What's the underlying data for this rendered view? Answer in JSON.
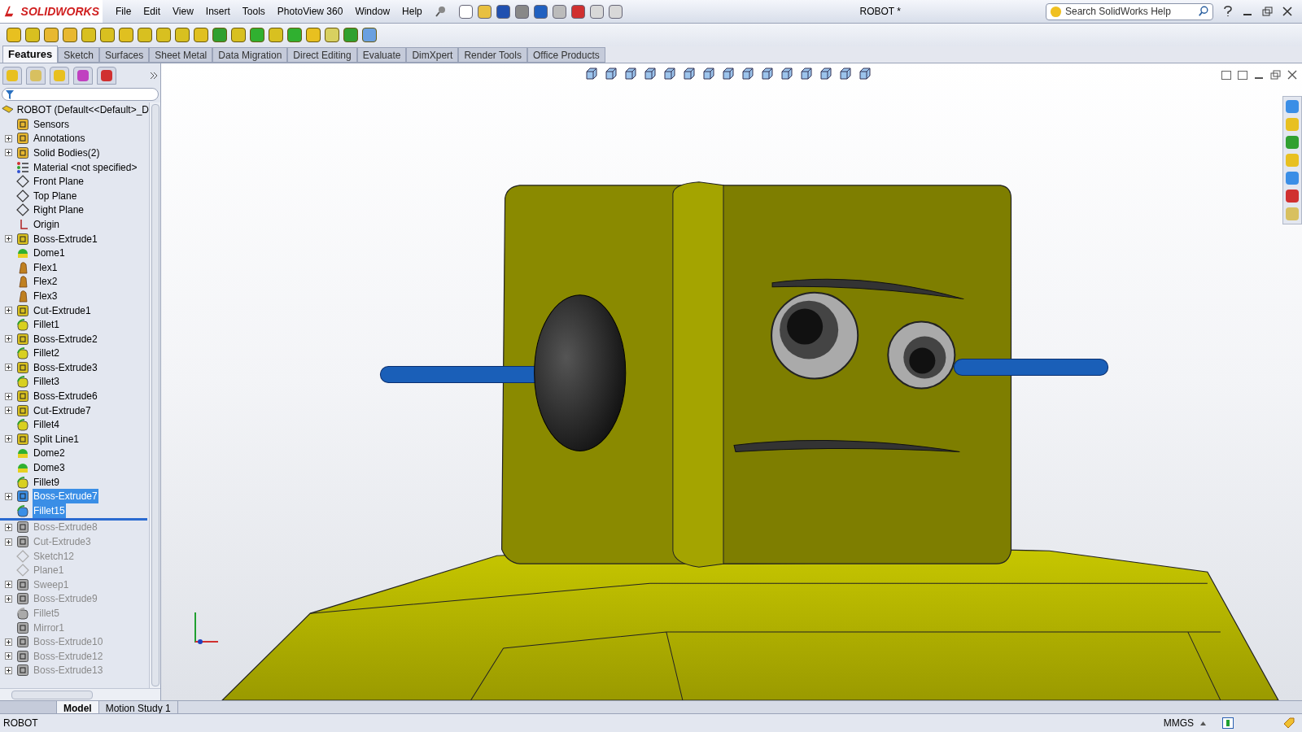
{
  "app": {
    "logo": "SOLIDWORKS",
    "title": "ROBOT *"
  },
  "menu": [
    "File",
    "Edit",
    "View",
    "Insert",
    "Tools",
    "PhotoView 360",
    "Window",
    "Help"
  ],
  "search": {
    "placeholder": "Search SolidWorks Help"
  },
  "command_tabs": [
    {
      "label": "Features",
      "selected": true
    },
    {
      "label": "Sketch",
      "selected": false
    },
    {
      "label": "Surfaces",
      "selected": false
    },
    {
      "label": "Sheet Metal",
      "selected": false
    },
    {
      "label": "Data Migration",
      "selected": false
    },
    {
      "label": "Direct Editing",
      "selected": false
    },
    {
      "label": "Evaluate",
      "selected": false
    },
    {
      "label": "DimXpert",
      "selected": false
    },
    {
      "label": "Render Tools",
      "selected": false
    },
    {
      "label": "Office Products",
      "selected": false
    }
  ],
  "feature_tree": {
    "root": "ROBOT  (Default<<Default>_D",
    "items": [
      {
        "label": "Sensors",
        "kind": "sensor",
        "expandable": false,
        "selected": false,
        "suppressed": false
      },
      {
        "label": "Annotations",
        "kind": "annotation",
        "expandable": true,
        "selected": false,
        "suppressed": false
      },
      {
        "label": "Solid Bodies(2)",
        "kind": "bodies",
        "expandable": true,
        "selected": false,
        "suppressed": false
      },
      {
        "label": "Material <not specified>",
        "kind": "material",
        "expandable": false,
        "selected": false,
        "suppressed": false
      },
      {
        "label": "Front Plane",
        "kind": "plane",
        "expandable": false,
        "selected": false,
        "suppressed": false
      },
      {
        "label": "Top Plane",
        "kind": "plane",
        "expandable": false,
        "selected": false,
        "suppressed": false
      },
      {
        "label": "Right Plane",
        "kind": "plane",
        "expandable": false,
        "selected": false,
        "suppressed": false
      },
      {
        "label": "Origin",
        "kind": "origin",
        "expandable": false,
        "selected": false,
        "suppressed": false
      },
      {
        "label": "Boss-Extrude1",
        "kind": "boss",
        "expandable": true,
        "selected": false,
        "suppressed": false
      },
      {
        "label": "Dome1",
        "kind": "dome",
        "expandable": false,
        "selected": false,
        "suppressed": false
      },
      {
        "label": "Flex1",
        "kind": "flex",
        "expandable": false,
        "selected": false,
        "suppressed": false
      },
      {
        "label": "Flex2",
        "kind": "flex",
        "expandable": false,
        "selected": false,
        "suppressed": false
      },
      {
        "label": "Flex3",
        "kind": "flex",
        "expandable": false,
        "selected": false,
        "suppressed": false
      },
      {
        "label": "Cut-Extrude1",
        "kind": "cut",
        "expandable": true,
        "selected": false,
        "suppressed": false
      },
      {
        "label": "Fillet1",
        "kind": "fillet",
        "expandable": false,
        "selected": false,
        "suppressed": false
      },
      {
        "label": "Boss-Extrude2",
        "kind": "boss",
        "expandable": true,
        "selected": false,
        "suppressed": false
      },
      {
        "label": "Fillet2",
        "kind": "fillet",
        "expandable": false,
        "selected": false,
        "suppressed": false
      },
      {
        "label": "Boss-Extrude3",
        "kind": "boss",
        "expandable": true,
        "selected": false,
        "suppressed": false
      },
      {
        "label": "Fillet3",
        "kind": "fillet",
        "expandable": false,
        "selected": false,
        "suppressed": false
      },
      {
        "label": "Boss-Extrude6",
        "kind": "boss",
        "expandable": true,
        "selected": false,
        "suppressed": false
      },
      {
        "label": "Cut-Extrude7",
        "kind": "cut",
        "expandable": true,
        "selected": false,
        "suppressed": false
      },
      {
        "label": "Fillet4",
        "kind": "fillet",
        "expandable": false,
        "selected": false,
        "suppressed": false
      },
      {
        "label": "Split Line1",
        "kind": "split",
        "expandable": true,
        "selected": false,
        "suppressed": false
      },
      {
        "label": "Dome2",
        "kind": "dome",
        "expandable": false,
        "selected": false,
        "suppressed": false
      },
      {
        "label": "Dome3",
        "kind": "dome",
        "expandable": false,
        "selected": false,
        "suppressed": false
      },
      {
        "label": "Fillet9",
        "kind": "fillet",
        "expandable": false,
        "selected": false,
        "suppressed": false
      },
      {
        "label": "Boss-Extrude7",
        "kind": "boss",
        "expandable": true,
        "selected": true,
        "suppressed": false
      },
      {
        "label": "Fillet15",
        "kind": "fillet",
        "expandable": false,
        "selected": true,
        "suppressed": false
      },
      {
        "kind": "rollback"
      },
      {
        "label": "Boss-Extrude8",
        "kind": "boss",
        "expandable": true,
        "selected": false,
        "suppressed": true
      },
      {
        "label": "Cut-Extrude3",
        "kind": "cut",
        "expandable": true,
        "selected": false,
        "suppressed": true
      },
      {
        "label": "Sketch12",
        "kind": "sketch",
        "expandable": false,
        "selected": false,
        "suppressed": true
      },
      {
        "label": "Plane1",
        "kind": "plane",
        "expandable": false,
        "selected": false,
        "suppressed": true
      },
      {
        "label": "Sweep1",
        "kind": "sweep",
        "expandable": true,
        "selected": false,
        "suppressed": true
      },
      {
        "label": "Boss-Extrude9",
        "kind": "boss",
        "expandable": true,
        "selected": false,
        "suppressed": true
      },
      {
        "label": "Fillet5",
        "kind": "fillet",
        "expandable": false,
        "selected": false,
        "suppressed": true
      },
      {
        "label": "Mirror1",
        "kind": "mirror",
        "expandable": false,
        "selected": false,
        "suppressed": true
      },
      {
        "label": "Boss-Extrude10",
        "kind": "boss",
        "expandable": true,
        "selected": false,
        "suppressed": true
      },
      {
        "label": "Boss-Extrude12",
        "kind": "boss",
        "expandable": true,
        "selected": false,
        "suppressed": true
      },
      {
        "label": "Boss-Extrude13",
        "kind": "boss",
        "expandable": true,
        "selected": false,
        "suppressed": true
      }
    ]
  },
  "bottom_tabs": [
    {
      "label": "Model",
      "selected": true
    },
    {
      "label": "Motion Study 1",
      "selected": false
    }
  ],
  "status_bar": {
    "document": "ROBOT",
    "units": "MMGS"
  }
}
